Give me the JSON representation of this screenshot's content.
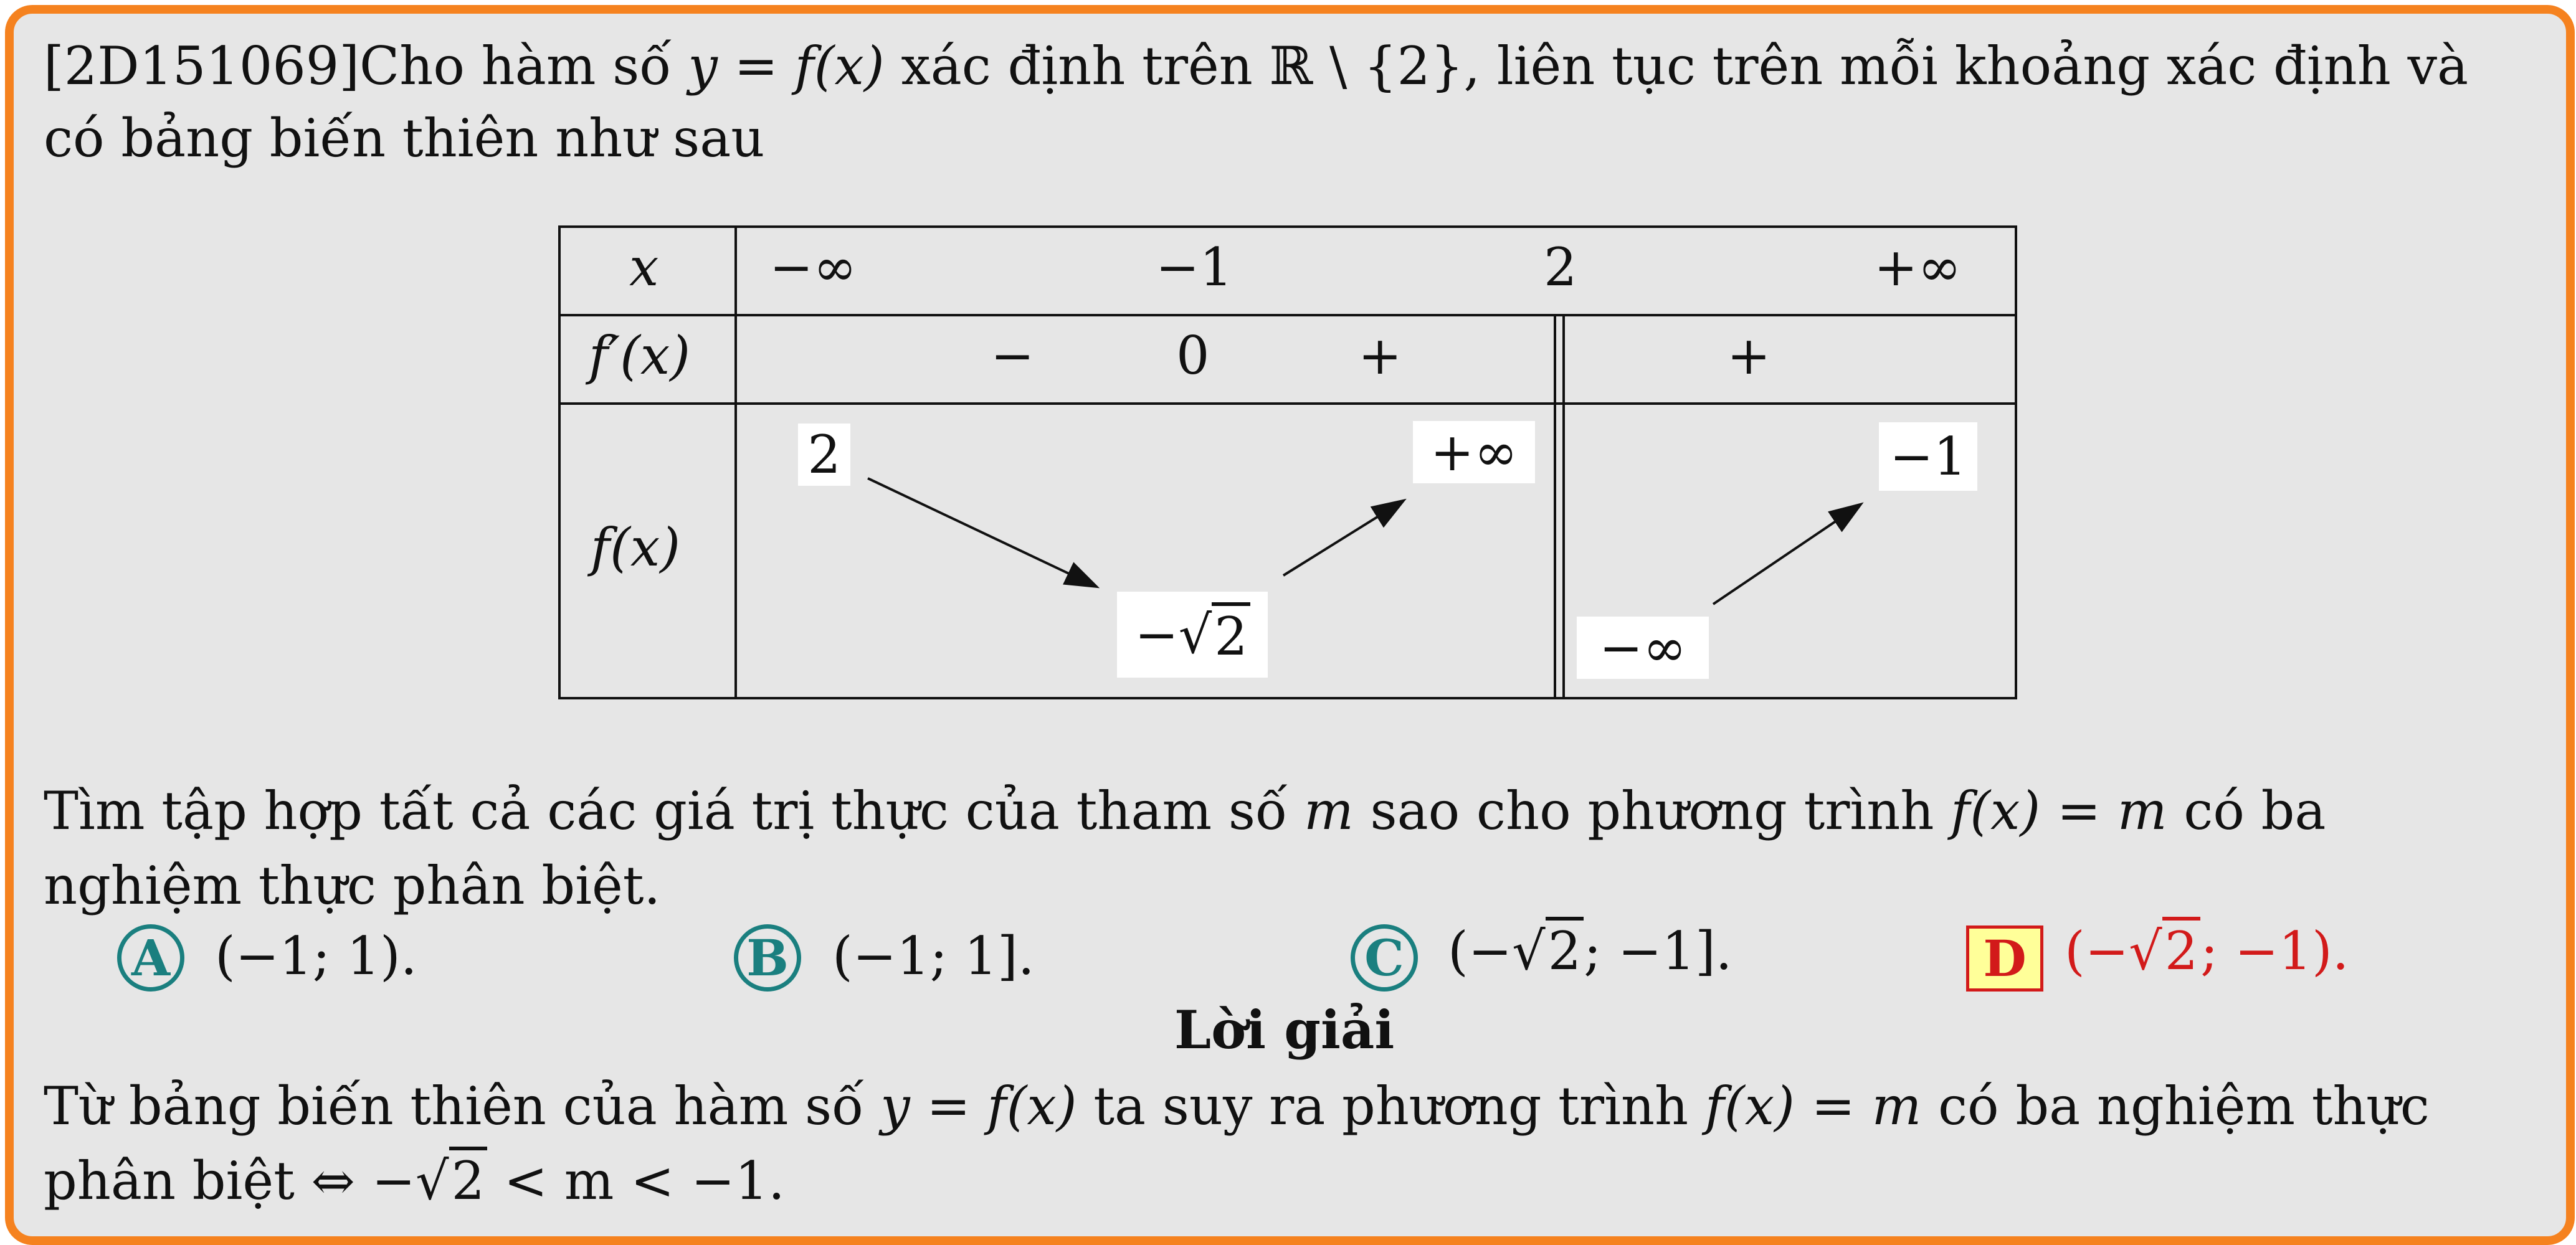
{
  "problem": {
    "code": "[2D151069]",
    "line1_a": "Cho hàm số ",
    "line1_b": "y = f(x)",
    "line1_c": " xác định trên ",
    "line1_d": "ℝ \\ {2}",
    "line1_e": ", liên tục trên mỗi khoảng xác định và",
    "line2": "có bảng biến thiên như sau"
  },
  "table": {
    "row_x_label": "x",
    "row_fp_label": "f′(x)",
    "row_f_label": "f(x)",
    "x_values": [
      "−∞",
      "−1",
      "2",
      "+∞"
    ],
    "fp_signs": [
      "−",
      "0",
      "+",
      "+"
    ],
    "f_values": {
      "start": "2",
      "min_prefix": "−",
      "min_radicand": "2",
      "left_limit": "+∞",
      "right_start": "−∞",
      "right_end": "−1"
    }
  },
  "question": {
    "line1_a": "Tìm tập hợp tất cả các giá trị thực của tham số ",
    "line1_b": "m",
    "line1_c": " sao cho phương trình ",
    "line1_d": "f(x) = m",
    "line1_e": " có ba",
    "line2": "nghiệm thực phân biệt."
  },
  "answers": {
    "A": {
      "letter": "A",
      "text": "(−1; 1)."
    },
    "B": {
      "letter": "B",
      "text": "(−1; 1]."
    },
    "C": {
      "letter": "C",
      "pre": "(−",
      "radicand": "2",
      "post": "; −1]."
    },
    "D": {
      "letter": "D",
      "pre": "(−",
      "radicand": "2",
      "post": "; −1)."
    }
  },
  "solution": {
    "title": "Lời giải",
    "line1_a": "Từ bảng biến thiên của hàm số ",
    "line1_b": "y = f(x)",
    "line1_c": " ta suy ra phương trình ",
    "line1_d": "f(x) = m",
    "line1_e": " có ba nghiệm thực",
    "line2_a": "phân biệt ⇔ −",
    "line2_rad": "2",
    "line2_b": " < m < −1."
  },
  "colors": {
    "frame": "#f5821f",
    "background": "#e6e6e6",
    "choice": "#1a7f7f",
    "correct": "#d21a1a",
    "correct_fill": "#ffff99"
  }
}
